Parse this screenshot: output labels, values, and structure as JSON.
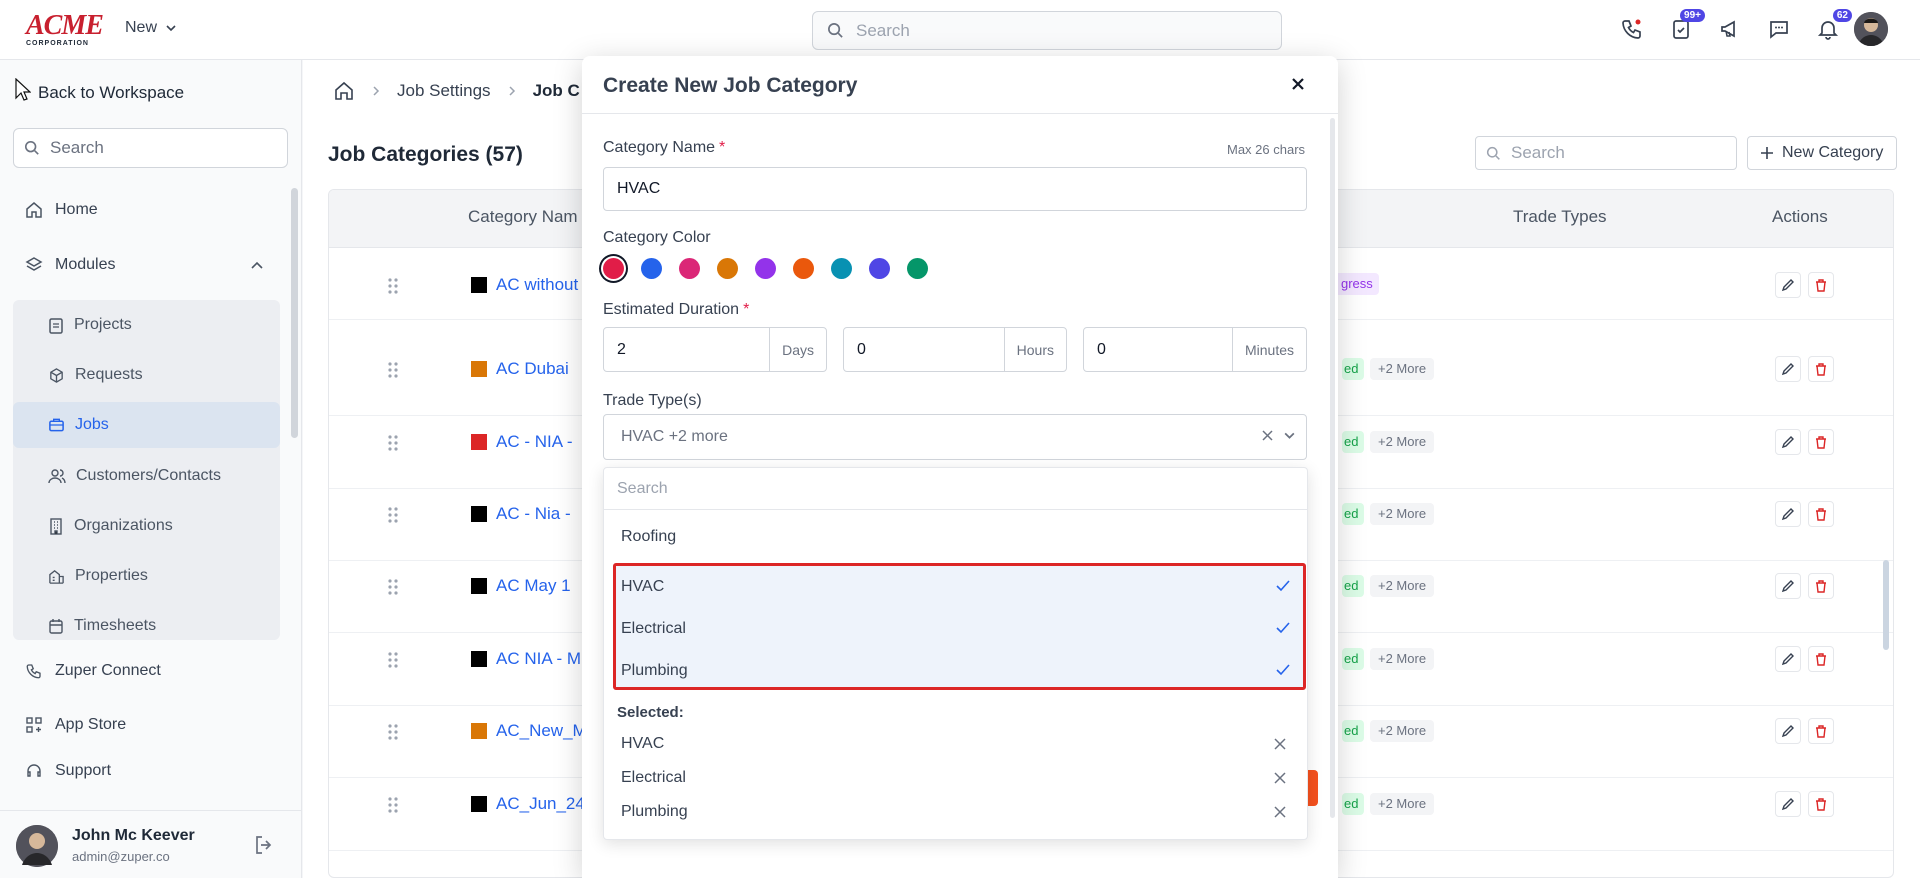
{
  "header": {
    "logo_text": "ACME",
    "logo_sub": "CORPORATION",
    "new_label": "New",
    "search_placeholder": "Search",
    "badges": {
      "tasks": "99+",
      "notifications": "62"
    }
  },
  "sidebar": {
    "back_label": "Back to Workspace",
    "search_placeholder": "Search",
    "home": "Home",
    "modules": "Modules",
    "sub_items": [
      "Projects",
      "Requests",
      "Jobs",
      "Customers/Contacts",
      "Organizations",
      "Properties",
      "Timesheets"
    ],
    "connect": "Zuper Connect",
    "app_store": "App Store",
    "support": "Support",
    "user": {
      "name": "John Mc Keever",
      "email": "admin@zuper.co"
    }
  },
  "main": {
    "breadcrumb": {
      "settings": "Job Settings",
      "current": "Job C"
    },
    "title": "Job Categories (57)",
    "search_placeholder": "Search",
    "new_button": "New Category",
    "columns": {
      "name": "Category Nam",
      "trade": "Trade Types",
      "actions": "Actions"
    },
    "rows": [
      {
        "name": "AC without",
        "color": "#000000",
        "status": "gress",
        "more": ""
      },
      {
        "name": "AC Dubai",
        "color": "#d97706",
        "status": "ed",
        "more": "+2 More"
      },
      {
        "name": "AC - NIA -",
        "color": "#dc2626",
        "status": "ed",
        "more": "+2 More"
      },
      {
        "name": "AC - Nia -",
        "color": "#000000",
        "status": "ed",
        "more": "+2 More"
      },
      {
        "name": "AC May 1",
        "color": "#000000",
        "status": "ed",
        "more": "+2 More"
      },
      {
        "name": "AC NIA - M",
        "color": "#000000",
        "status": "ed",
        "more": "+2 More"
      },
      {
        "name": "AC_New_M",
        "color": "#d97706",
        "status": "ed",
        "more": "+2 More"
      },
      {
        "name": "AC_Jun_24",
        "color": "#000000",
        "status": "ed",
        "more": "+2 More"
      }
    ]
  },
  "modal": {
    "title": "Create New Job Category",
    "category_name_label": "Category Name",
    "max_hint": "Max 26 chars",
    "category_name_value": "HVAC",
    "color_label": "Category Color",
    "colors": [
      "#e11d48",
      "#2563eb",
      "#db2777",
      "#d97706",
      "#9333ea",
      "#ea580c",
      "#0891b2",
      "#4f46e5",
      "#059669"
    ],
    "duration_label": "Estimated Duration",
    "days_value": "2",
    "days_unit": "Days",
    "hours_value": "0",
    "hours_unit": "Hours",
    "minutes_value": "0",
    "minutes_unit": "Minutes",
    "trade_label": "Trade Type(s)",
    "trade_value": "HVAC +2 more"
  },
  "dropdown": {
    "search_placeholder": "Search",
    "unselected": [
      "Roofing"
    ],
    "selected_options": [
      "HVAC",
      "Electrical",
      "Plumbing"
    ],
    "selected_title": "Selected:",
    "selected_list": [
      "HVAC",
      "Electrical",
      "Plumbing"
    ]
  }
}
